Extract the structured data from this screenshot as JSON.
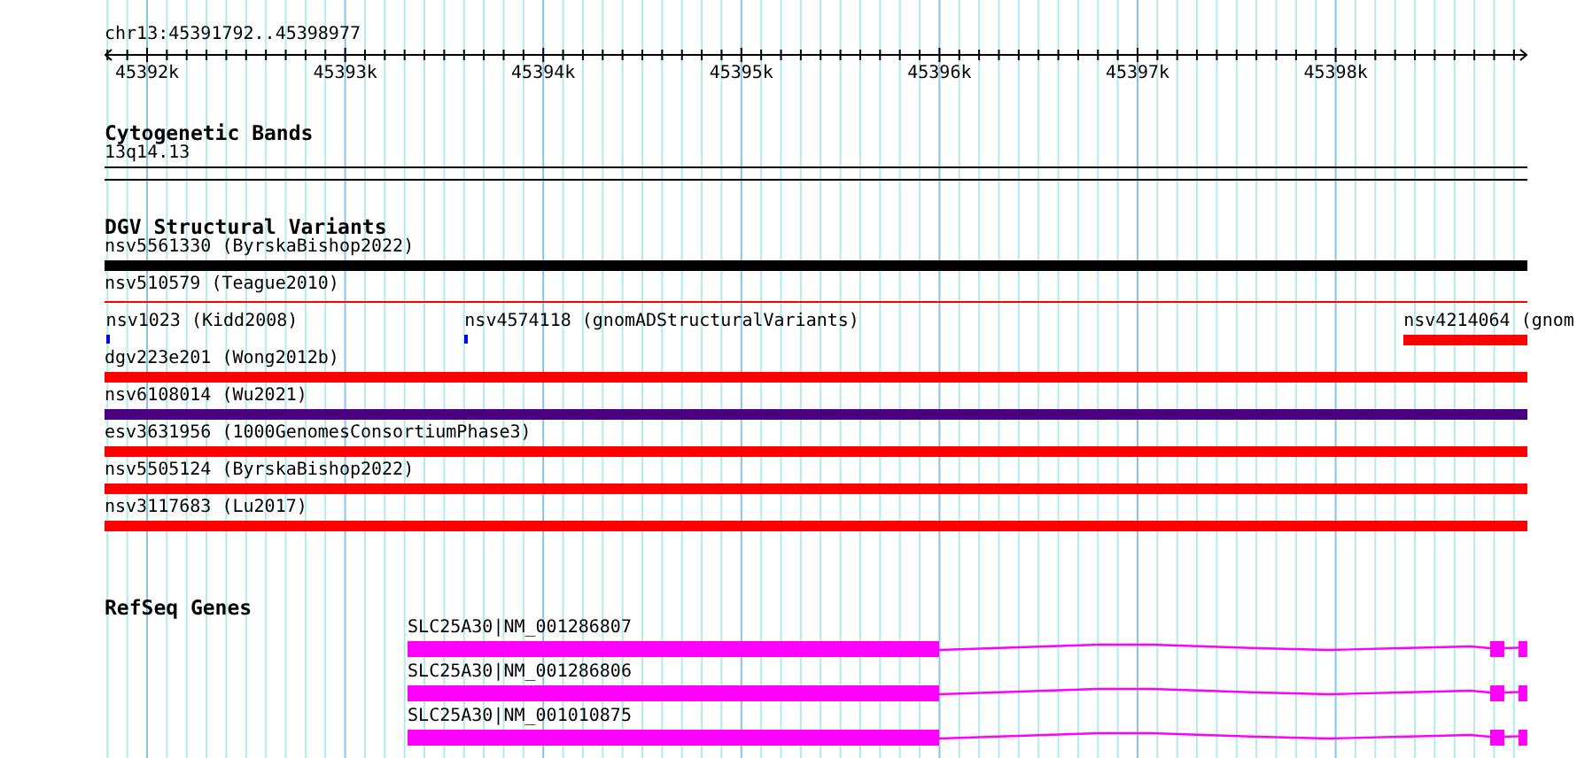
{
  "ruler": {
    "location": "chr13:45391792..45398977",
    "ticks": [
      "45392k",
      "45393k",
      "45394k",
      "45395k",
      "45396k",
      "45397k",
      "45398k"
    ]
  },
  "tracks": [
    {
      "kind": "cytoband",
      "title": "Cytogenetic Bands",
      "label": "13q14.13"
    },
    {
      "kind": "variants",
      "title": "DGV Structural Variants",
      "rows": [
        {
          "features": [
            {
              "label": "nsv5561330 (ByrskaBishop2022)",
              "kind": "bar",
              "color": "#000000"
            }
          ]
        },
        {
          "features": [
            {
              "label": "nsv510579 (Teague2010)",
              "kind": "line",
              "color": "#ff0000"
            }
          ]
        },
        {
          "features": [
            {
              "label": "nsv1023 (Kidd2008)",
              "kind": "tick",
              "color": "#0000ff"
            },
            {
              "label": "nsv4574118 (gnomADStructuralVariants)",
              "kind": "tick",
              "color": "#0000ff"
            },
            {
              "label": "nsv4214064 (gnom",
              "kind": "bar",
              "color": "#ff0000"
            }
          ]
        },
        {
          "features": [
            {
              "label": "dgv223e201 (Wong2012b)",
              "kind": "bar",
              "color": "#ff0000"
            }
          ]
        },
        {
          "features": [
            {
              "label": "nsv6108014 (Wu2021)",
              "kind": "bar",
              "color": "#4b0082"
            }
          ]
        },
        {
          "features": [
            {
              "label": "esv3631956 (1000GenomesConsortiumPhase3)",
              "kind": "bar",
              "color": "#ff0000"
            }
          ]
        },
        {
          "features": [
            {
              "label": "nsv5505124 (ByrskaBishop2022)",
              "kind": "bar",
              "color": "#ff0000"
            }
          ]
        },
        {
          "features": [
            {
              "label": "nsv3117683 (Lu2017)",
              "kind": "bar",
              "color": "#ff0000"
            }
          ]
        }
      ]
    },
    {
      "kind": "genes",
      "title": "RefSeq Genes",
      "genes": [
        {
          "label": "SLC25A30|NM_001286807"
        },
        {
          "label": "SLC25A30|NM_001286806"
        },
        {
          "label": "SLC25A30|NM_001010875"
        }
      ]
    }
  ]
}
